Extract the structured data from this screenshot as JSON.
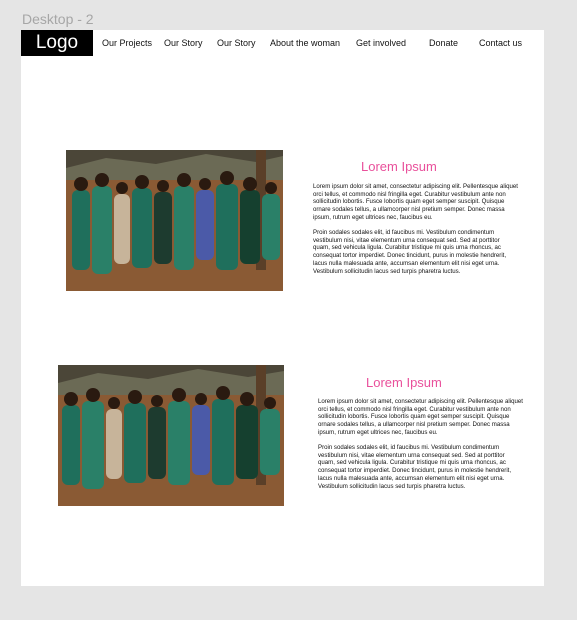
{
  "frame_label": "Desktop - 2",
  "logo": "Logo",
  "nav": [
    "Our Projects",
    "Our Story",
    "Our Story",
    "About the woman",
    "Get involved",
    "Donate",
    "Contact us"
  ],
  "sections": [
    {
      "title": "Lorem Ipsum",
      "paragraphs": [
        "Lorem ipsum dolor sit amet, consectetur adipiscing elit. Pellentesque aliquet orci tellus, et commodo nisl fringilla eget. Curabitur vestibulum ante non sollicitudin lobortis. Fusce lobortis quam eget semper suscipit. Quisque ornare sodales tellus, a ullamcorper nisl pretium semper. Donec massa ipsum, rutrum eget ultrices nec, faucibus eu.",
        "Proin sodales sodales elit, id faucibus mi. Vestibulum condimentum vestibulum nisi, vitae elementum urna consequat sed. Sed at porttitor quam, sed vehicula ligula. Curabitur tristique mi quis urna rhoncus, ac consequat tortor imperdiet. Donec tincidunt, purus in molestie hendrerit, lacus nulla malesuada ante, accumsan elementum elit nisi eget urna. Vestibulum sollicitudin lacus sed turpis pharetra luctus."
      ]
    },
    {
      "title": "Lorem Ipsum",
      "paragraphs": [
        "Lorem ipsum dolor sit amet, consectetur adipiscing elit. Pellentesque aliquet orci tellus, et commodo nisl fringilla eget. Curabitur vestibulum ante non sollicitudin lobortis. Fusce lobortis quam eget semper suscipit. Quisque ornare sodales tellus, a ullamcorper nisl pretium semper. Donec massa ipsum, rutrum eget ultrices nec, faucibus eu.",
        "Proin sodales sodales elit, id faucibus mi. Vestibulum condimentum vestibulum nisi, vitae elementum urna consequat sed. Sed at porttitor quam, sed vehicula ligula. Curabitur tristique mi quis urna rhoncus, ac consequat tortor imperdiet. Donec tincidunt, purus in molestie hendrerit, lacus nulla malesuada ante, accumsan elementum elit nisi eget urna. Vestibulum sollicitudin lacus sed turpis pharetra luctus."
      ]
    }
  ],
  "colors": {
    "accent": "#e9509b",
    "logo_bg": "#000000",
    "canvas_bg": "#ffffff",
    "outer_bg": "#e5e5e5"
  }
}
